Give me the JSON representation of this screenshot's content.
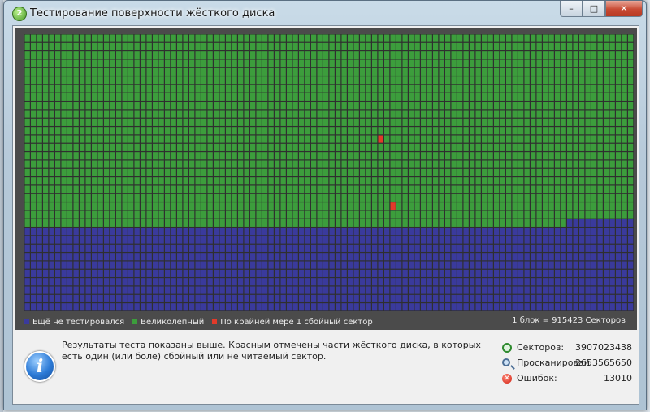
{
  "window": {
    "title": "Тестирование поверхности жёсткого диска",
    "app_icon_glyph": "2",
    "minimize_glyph": "–",
    "maximize_glyph": "□",
    "close_glyph": "✕"
  },
  "surface_map": {
    "columns": 100,
    "rows": 33,
    "tested_full_rows": 22,
    "tested_cells_in_partial_row": 89,
    "bad_cells": [
      {
        "row": 12,
        "col": 58
      },
      {
        "row": 20,
        "col": 60
      }
    ],
    "colors": {
      "untested": "#3a3a9c",
      "good": "#3c9d3c",
      "bad": "#e23a2a",
      "grid_bg": "#2f2f2f"
    }
  },
  "legend": {
    "untested": "Ещё не тестировался",
    "good": "Великолепный",
    "bad": "По крайней мере 1 сбойный сектор",
    "block_info": "1 блок = 915423 Секторов"
  },
  "info": {
    "icon": "info-icon",
    "glyph": "i",
    "message": "Результаты теста показаны выше. Красным отмечены части жёсткого диска, в которых есть один (или боле) сбойный или не читаемый сектор."
  },
  "stats": {
    "sectors_label": "Секторов:",
    "sectors_value": "3907023438",
    "scanned_label": "Просканирован",
    "scanned_value": "2653565650",
    "errors_label": "Ошибок:",
    "errors_value": "13010",
    "error_glyph": "✕"
  }
}
